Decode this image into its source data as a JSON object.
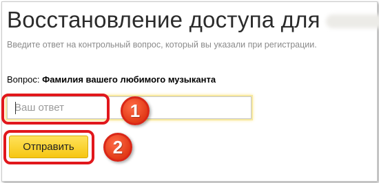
{
  "page": {
    "title": "Восстановление доступа для",
    "subtitle": "Введите ответ на контрольный вопрос, который вы указали при регистрации."
  },
  "question": {
    "label": "Вопрос:",
    "text": "Фамилия вашего любимого музыканта"
  },
  "answer": {
    "placeholder": "Ваш ответ",
    "value": ""
  },
  "submit": {
    "label": "Отправить"
  },
  "annotations": {
    "step1": "1",
    "step2": "2"
  },
  "colors": {
    "accent_button": "#ffdb4d",
    "highlight_ring": "#e1171c",
    "badge": "#e9441f"
  }
}
